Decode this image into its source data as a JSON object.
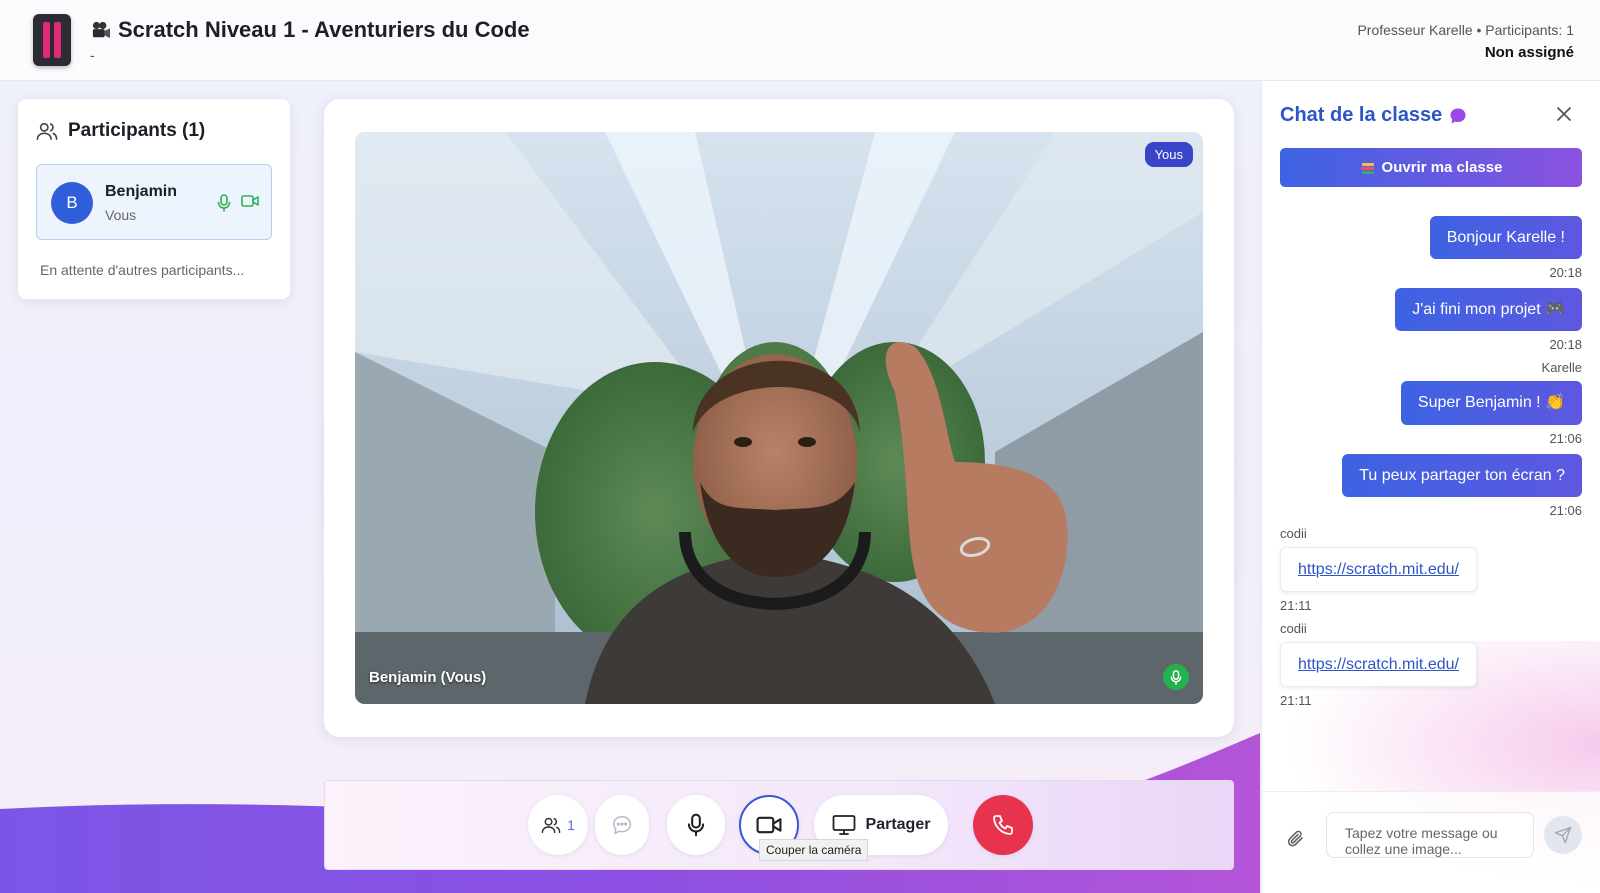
{
  "header": {
    "title": "Scratch Niveau 1 - Aventuriers du Code",
    "subtitle": "-",
    "teacher_info": "Professeur Karelle • Participants: 1",
    "assign_status": "Non assigné"
  },
  "participants": {
    "heading": "Participants (1)",
    "list": [
      {
        "initial": "B",
        "name": "Benjamin",
        "role": "Vous"
      }
    ],
    "waiting_text": "En attente d'autres participants..."
  },
  "video": {
    "badge": "Yous",
    "name_label": "Benjamin (Vous)"
  },
  "controls": {
    "participants_count": "1",
    "share_label": "Partager",
    "camera_tooltip": "Couper la caméra"
  },
  "chat": {
    "title": "Chat de la classe",
    "open_class_label": "Ouvrir ma classe",
    "messages": [
      {
        "direction": "out",
        "text": "Bonjour Karelle !",
        "time": "20:18"
      },
      {
        "direction": "out",
        "text": "J'ai fini mon projet 🎮",
        "time": "20:18"
      },
      {
        "direction": "out",
        "sender": "Karelle",
        "text": "Super Benjamin ! 👏",
        "time": "21:06"
      },
      {
        "direction": "out",
        "text": "Tu peux partager ton écran ?",
        "time": "21:06"
      },
      {
        "direction": "in",
        "sender": "codii",
        "text": "https://scratch.mit.edu/",
        "time": "21:11"
      },
      {
        "direction": "in",
        "sender": "codii",
        "text": "https://scratch.mit.edu/",
        "time": "21:11"
      }
    ],
    "input_placeholder": "Tapez votre message ou collez une image..."
  },
  "colors": {
    "accent_blue": "#2e55c8",
    "button_gradient_start": "#3d63e2",
    "button_gradient_end": "#8a52e0",
    "hangup_red": "#e8334f",
    "mic_green": "#22b14c",
    "logo_pink": "#e02a7a"
  },
  "icons": {
    "participants": "users-icon",
    "mic": "microphone-icon",
    "camera": "video-camera-icon",
    "share": "monitor-icon",
    "hangup": "phone-icon",
    "chat": "chat-bubble-icon",
    "close": "close-icon",
    "attach": "paperclip-icon",
    "send": "send-icon"
  }
}
